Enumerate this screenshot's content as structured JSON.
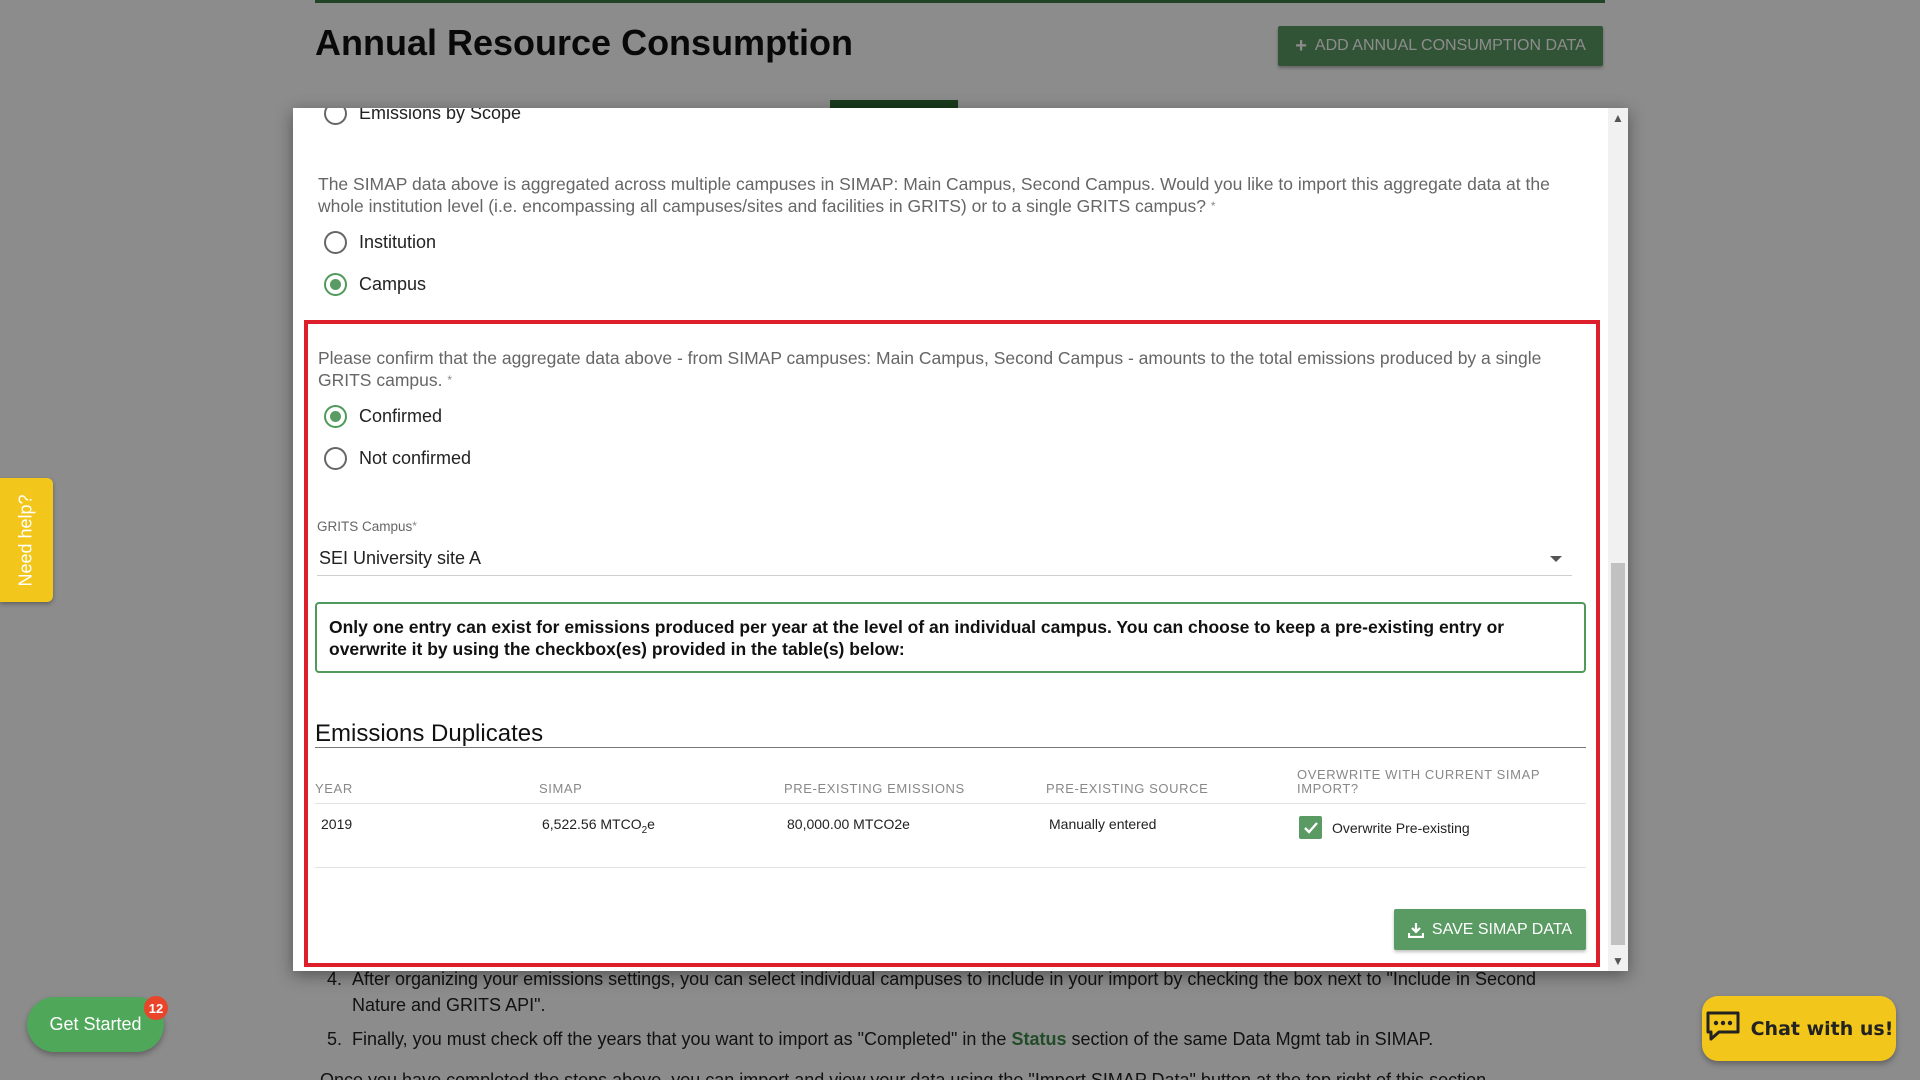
{
  "page": {
    "title": "Annual Resource Consumption",
    "add_button": "ADD ANNUAL CONSUMPTION DATA",
    "steps": [
      {
        "num": "4.",
        "text": "After organizing your emissions settings, you can select individual campuses to include in your import by checking the box next to \"Include in Second Nature and GRITS API\"."
      },
      {
        "num": "5.",
        "pre": "Finally, you must check off the years that you want to import as \"Completed\" in the ",
        "link": "Status",
        "post": " section of the same Data Mgmt tab in SIMAP."
      }
    ],
    "last_line": "Once you have completed the steps above, you can import and view your data using the \"Import SIMAP Data\" button at the top right of this section."
  },
  "help_tab": "Need help?",
  "get_started": {
    "label": "Get Started",
    "badge": "12"
  },
  "chat": {
    "label": "Chat with us!"
  },
  "modal": {
    "prev_option": "Emissions by Scope",
    "level_question": "The SIMAP data above is aggregated across multiple campuses in SIMAP: Main Campus, Second Campus. Would you like to import this aggregate data at the whole institution level (i.e. encompassing all campuses/sites and facilities in GRITS) or to a single GRITS campus?",
    "required_mark": "*",
    "level_options": [
      {
        "label": "Institution",
        "checked": false
      },
      {
        "label": "Campus",
        "checked": true
      }
    ],
    "confirm_question": "Please confirm that the aggregate data above - from SIMAP campuses: Main Campus, Second Campus - amounts to the total emissions produced by a single GRITS campus.",
    "confirm_options": [
      {
        "label": "Confirmed",
        "checked": true
      },
      {
        "label": "Not confirmed",
        "checked": false
      }
    ],
    "campus_field": {
      "label": "GRITS Campus",
      "value": "SEI University site A"
    },
    "notice": "Only one entry can exist for emissions produced per year at the level of an individual campus. You can choose to keep a pre-existing entry or overwrite it by using the checkbox(es) provided in the table(s) below:",
    "duplicates": {
      "title": "Emissions Duplicates",
      "headers": [
        "YEAR",
        "SIMAP",
        "PRE-EXISTING EMISSIONS",
        "PRE-EXISTING SOURCE",
        "OVERWRITE WITH CURRENT SIMAP IMPORT?"
      ],
      "rows": [
        {
          "year": "2019",
          "simap": "6,522.56 MTCO",
          "simap_sub": "2",
          "simap_suffix": "e",
          "pre_emissions": "80,000.00 MTCO2e",
          "pre_source": "Manually entered",
          "overwrite_label": "Overwrite Pre-existing",
          "overwrite_checked": true
        }
      ]
    },
    "save_button": "SAVE SIMAP DATA"
  },
  "colors": {
    "accent": "#5a9a63",
    "highlight": "#dc1f2b",
    "help": "#f3c61b"
  }
}
